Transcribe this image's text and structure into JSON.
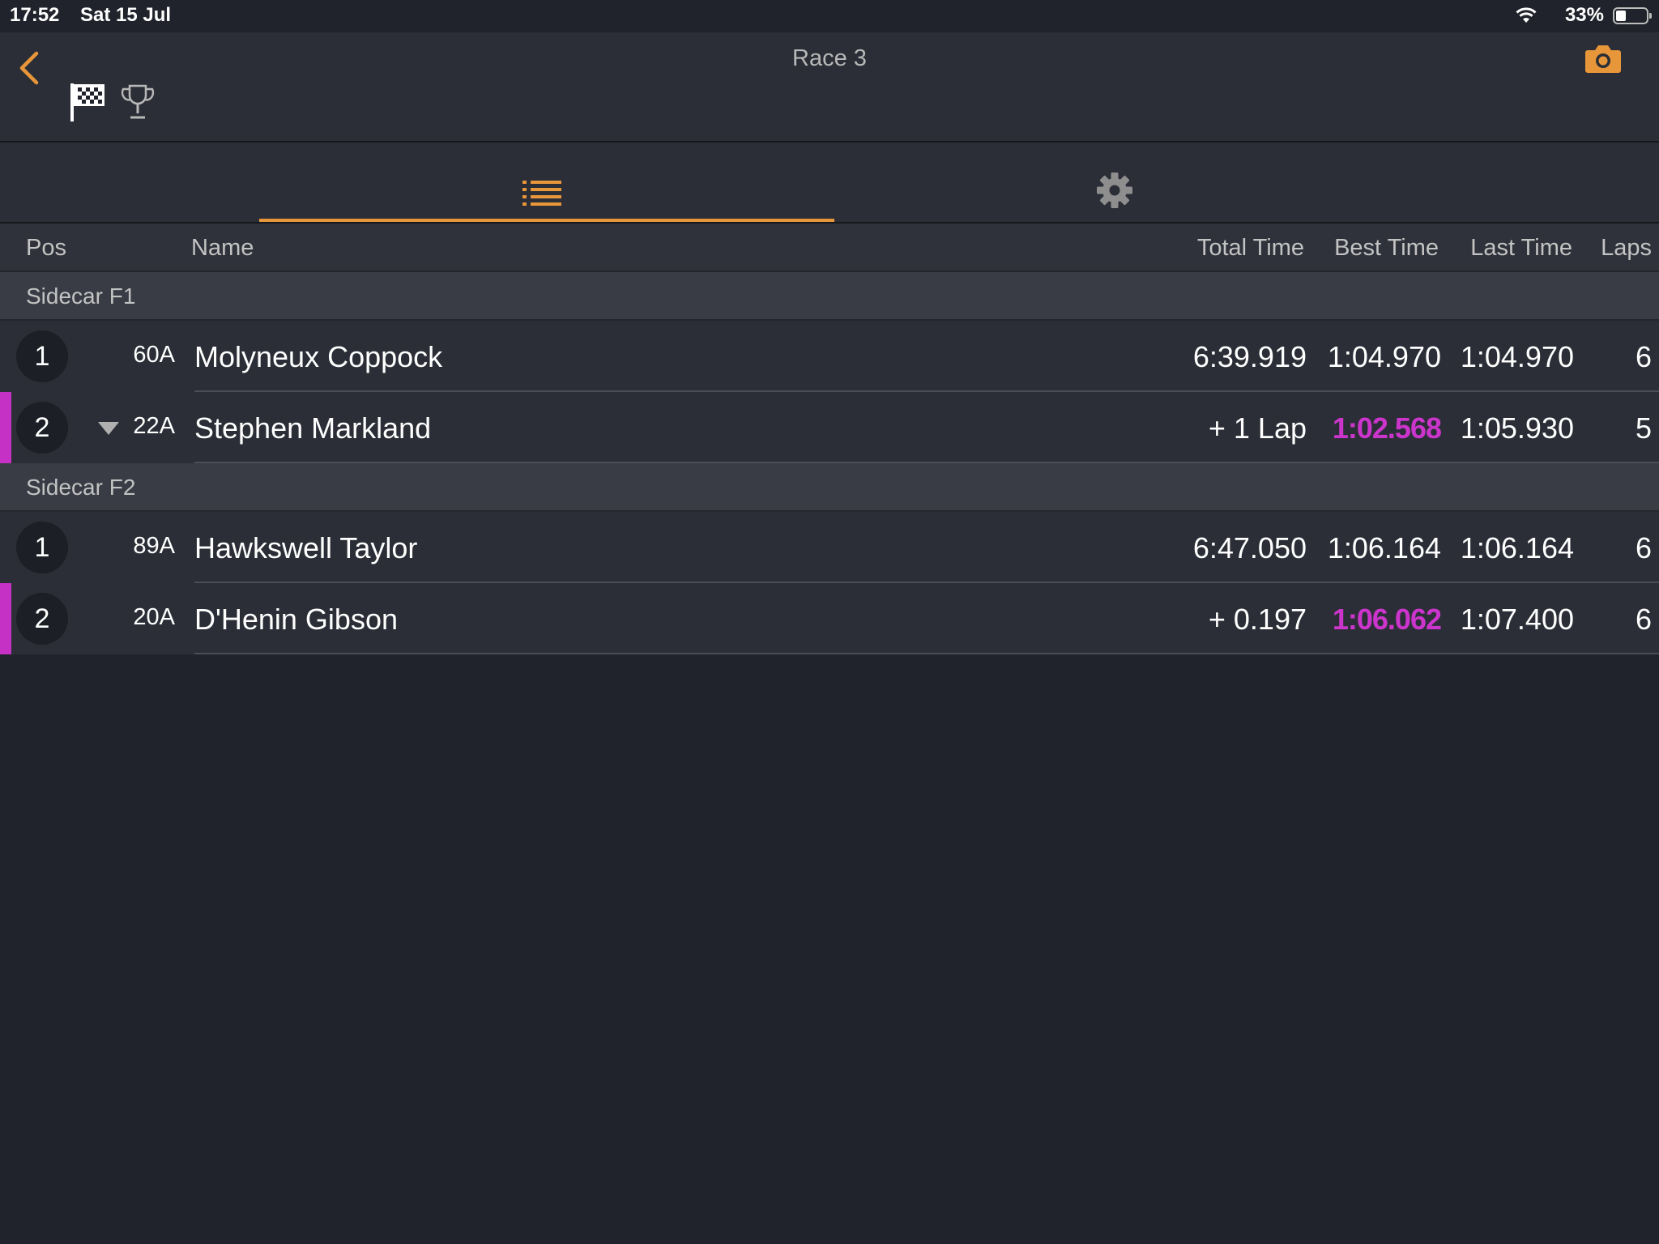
{
  "status_bar": {
    "time": "17:52",
    "date": "Sat 15 Jul",
    "battery_percent": "33%",
    "battery_level": 0.33
  },
  "nav": {
    "title": "Race 3",
    "back_icon": "chevron-left-icon",
    "camera_icon": "camera-icon",
    "flag_icon": "checkered-flag-icon",
    "trophy_icon": "trophy-icon"
  },
  "tabs": [
    {
      "icon": "list-icon",
      "active": true
    },
    {
      "icon": "gear-icon",
      "active": false
    }
  ],
  "columns": {
    "pos": "Pos",
    "name": "Name",
    "total": "Total Time",
    "best": "Best Time",
    "last": "Last Time",
    "laps": "Laps"
  },
  "sections": [
    {
      "title": "Sidecar F1",
      "rows": [
        {
          "pos": "1",
          "num": "60A",
          "name": "Molyneux Coppock",
          "total": "6:39.919",
          "best": "1:04.970",
          "last": "1:04.970",
          "laps": "6",
          "best_fastest": false,
          "marker": false,
          "down_arrow": false
        },
        {
          "pos": "2",
          "num": "22A",
          "name": "Stephen Markland",
          "total": "+ 1 Lap",
          "best": "1:02.568",
          "last": "1:05.930",
          "laps": "5",
          "best_fastest": true,
          "marker": true,
          "down_arrow": true
        }
      ]
    },
    {
      "title": "Sidecar F2",
      "rows": [
        {
          "pos": "1",
          "num": "89A",
          "name": "Hawkswell Taylor",
          "total": "6:47.050",
          "best": "1:06.164",
          "last": "1:06.164",
          "laps": "6",
          "best_fastest": false,
          "marker": false,
          "down_arrow": false
        },
        {
          "pos": "2",
          "num": "20A",
          "name": "D'Henin Gibson",
          "total": "+ 0.197",
          "best": "1:06.062",
          "last": "1:07.400",
          "laps": "6",
          "best_fastest": true,
          "marker": true,
          "down_arrow": false
        }
      ]
    }
  ],
  "colors": {
    "accent": "#e8963a",
    "fastest": "#cc35cc",
    "background": "#20232b"
  }
}
